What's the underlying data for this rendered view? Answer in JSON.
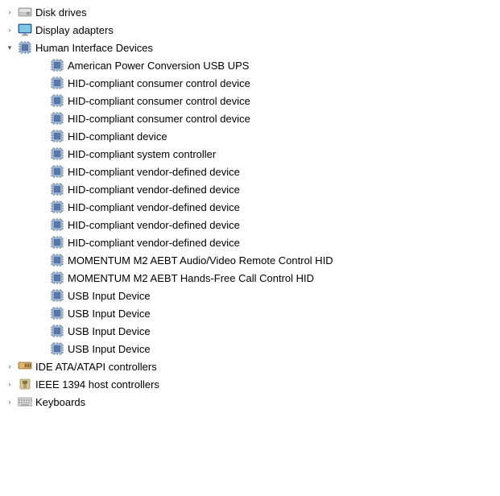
{
  "tree": {
    "items": [
      {
        "id": "disk-drives",
        "label": "Disk drives",
        "indent": 0,
        "expanded": false,
        "collapsible": true,
        "icon": "disk",
        "children": []
      },
      {
        "id": "display-adapters",
        "label": "Display adapters",
        "indent": 0,
        "expanded": false,
        "collapsible": true,
        "icon": "display",
        "children": []
      },
      {
        "id": "human-interface-devices",
        "label": "Human Interface Devices",
        "indent": 0,
        "expanded": true,
        "collapsible": true,
        "icon": "hid",
        "children": [
          {
            "id": "apc-usb-ups",
            "label": "American Power Conversion USB UPS",
            "icon": "hid"
          },
          {
            "id": "hid-consumer-1",
            "label": "HID-compliant consumer control device",
            "icon": "hid"
          },
          {
            "id": "hid-consumer-2",
            "label": "HID-compliant consumer control device",
            "icon": "hid"
          },
          {
            "id": "hid-consumer-3",
            "label": "HID-compliant consumer control device",
            "icon": "hid"
          },
          {
            "id": "hid-device",
            "label": "HID-compliant device",
            "icon": "hid"
          },
          {
            "id": "hid-system-controller",
            "label": "HID-compliant system controller",
            "icon": "hid"
          },
          {
            "id": "hid-vendor-1",
            "label": "HID-compliant vendor-defined device",
            "icon": "hid"
          },
          {
            "id": "hid-vendor-2",
            "label": "HID-compliant vendor-defined device",
            "icon": "hid"
          },
          {
            "id": "hid-vendor-3",
            "label": "HID-compliant vendor-defined device",
            "icon": "hid"
          },
          {
            "id": "hid-vendor-4",
            "label": "HID-compliant vendor-defined device",
            "icon": "hid"
          },
          {
            "id": "hid-vendor-5",
            "label": "HID-compliant vendor-defined device",
            "icon": "hid"
          },
          {
            "id": "momentum-audio",
            "label": "MOMENTUM M2 AEBT Audio/Video Remote Control HID",
            "icon": "hid"
          },
          {
            "id": "momentum-hands-free",
            "label": "MOMENTUM M2 AEBT Hands-Free Call Control HID",
            "icon": "hid"
          },
          {
            "id": "usb-input-1",
            "label": "USB Input Device",
            "icon": "hid"
          },
          {
            "id": "usb-input-2",
            "label": "USB Input Device",
            "icon": "hid"
          },
          {
            "id": "usb-input-3",
            "label": "USB Input Device",
            "icon": "hid"
          },
          {
            "id": "usb-input-4",
            "label": "USB Input Device",
            "icon": "hid"
          }
        ]
      },
      {
        "id": "ide-ata",
        "label": "IDE ATA/ATAPI controllers",
        "indent": 0,
        "expanded": false,
        "collapsible": true,
        "icon": "ide",
        "children": []
      },
      {
        "id": "ieee-1394",
        "label": "IEEE 1394 host controllers",
        "indent": 0,
        "expanded": false,
        "collapsible": true,
        "icon": "ieee",
        "children": []
      },
      {
        "id": "keyboards",
        "label": "Keyboards",
        "indent": 0,
        "expanded": false,
        "collapsible": true,
        "icon": "keyboard",
        "children": []
      }
    ]
  }
}
